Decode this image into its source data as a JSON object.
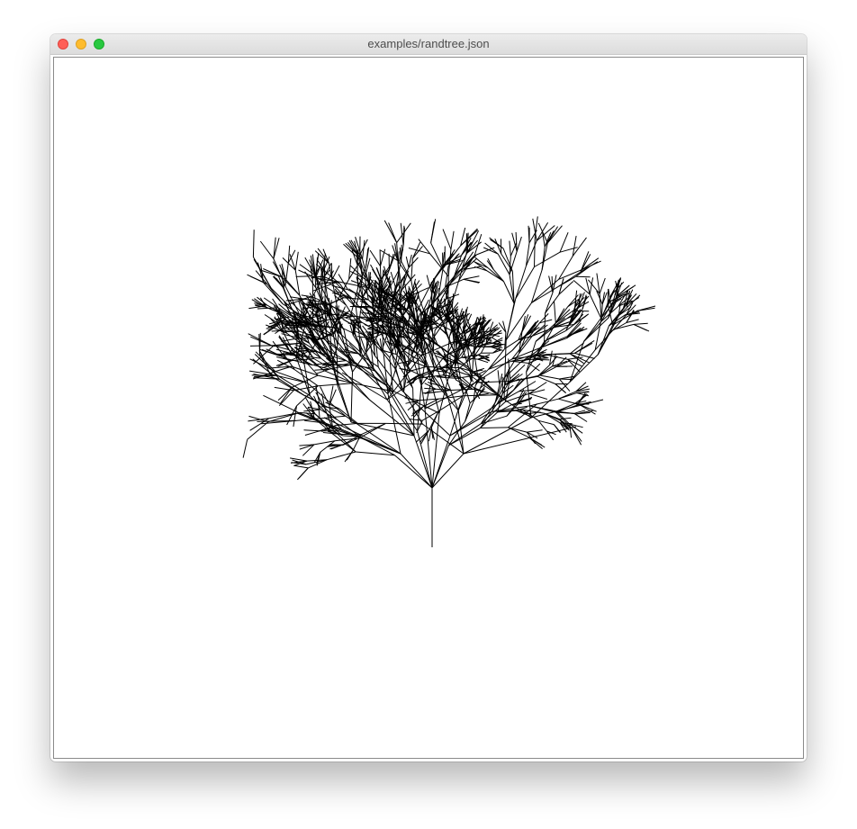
{
  "window": {
    "title": "examples/randtree.json"
  },
  "controls": [
    "close",
    "minimize",
    "maximize"
  ],
  "colors": {
    "close": "#ff5f57",
    "minimize": "#febc2e",
    "maximize": "#28c840",
    "stroke": "#000000"
  },
  "scene": {
    "icon": "random-tree-drawing"
  }
}
